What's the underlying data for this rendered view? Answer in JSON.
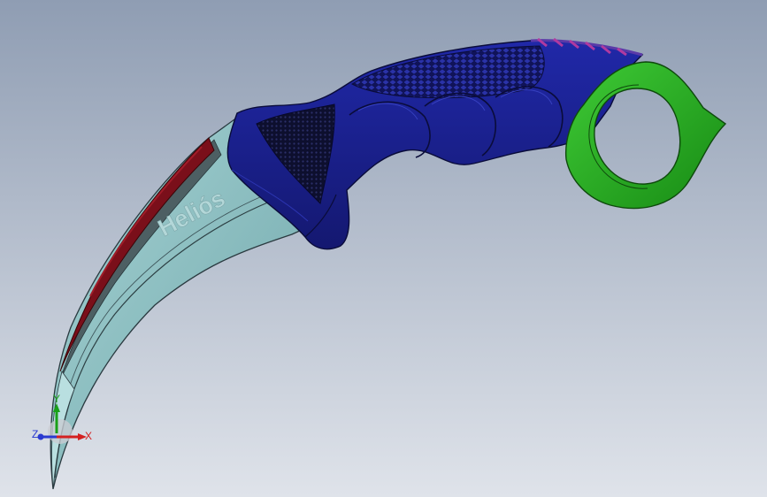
{
  "viewport": {
    "background_top": "#8f9db3",
    "background_bottom": "#dfe3ea"
  },
  "model": {
    "engraving_text": "Heliós",
    "parts": [
      {
        "name": "blade",
        "color": "#8fc4c6"
      },
      {
        "name": "blade-spine-edge",
        "color": "#7a0f1a"
      },
      {
        "name": "handle",
        "color": "#1a1f8c"
      },
      {
        "name": "finger-ring",
        "color": "#22a81e"
      }
    ]
  },
  "triad": {
    "x_label": "X",
    "y_label": "Y",
    "z_label": "Z",
    "x_color": "#d42020",
    "y_color": "#19a019",
    "z_color": "#2a3ad0"
  }
}
